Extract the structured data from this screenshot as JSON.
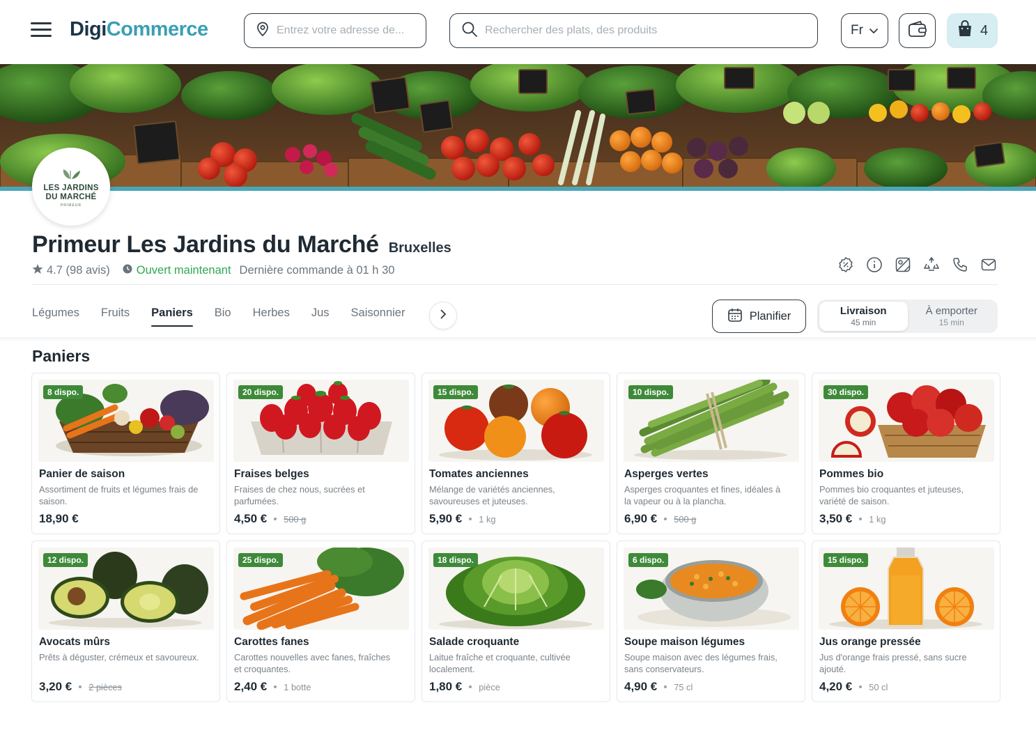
{
  "header": {
    "logo_part1": "Digi",
    "logo_part2": "Commerce",
    "address_placeholder": "Entrez votre adresse de...",
    "search_placeholder": "Rechercher des plats, des produits",
    "language": "Fr",
    "cart_count": "4"
  },
  "store": {
    "logo_line1": "LES JARDINS",
    "logo_line2": "DU MARCHÉ",
    "logo_sub": "PRIMEUR",
    "name": "Primeur Les Jardins du Marché",
    "city": "Bruxelles",
    "rating": "4.7 (98 avis)",
    "status": "Ouvert maintenant",
    "last_order": "Dernière commande à 01 h 30"
  },
  "tabs": [
    {
      "label": "Légumes"
    },
    {
      "label": "Fruits"
    },
    {
      "label": "Paniers"
    },
    {
      "label": "Bio"
    },
    {
      "label": "Herbes"
    },
    {
      "label": "Jus"
    },
    {
      "label": "Saisonnier"
    }
  ],
  "active_tab": "Paniers",
  "plan_label": "Planifier",
  "modes": [
    {
      "label": "Livraison",
      "time": "45 min"
    },
    {
      "label": "À emporter",
      "time": "15 min"
    }
  ],
  "section_title": "Paniers",
  "products": [
    {
      "badge": "8 dispo.",
      "name": "Panier de saison",
      "desc": "Assortiment de fruits et légumes frais de saison.",
      "price": "18,90 €",
      "unit": ""
    },
    {
      "badge": "20 dispo.",
      "name": "Fraises belges",
      "desc": "Fraises de chez nous, sucrées et parfumées.",
      "price": "4,50 €",
      "unit": "500 g"
    },
    {
      "badge": "15 dispo.",
      "name": "Tomates anciennes",
      "desc": "Mélange de variétés anciennes, savoureuses et juteuses.",
      "price": "5,90 €",
      "unit": "1 kg"
    },
    {
      "badge": "10 dispo.",
      "name": "Asperges vertes",
      "desc": "Asperges croquantes et fines, idéales à la vapeur ou à la plancha.",
      "price": "6,90 €",
      "unit": "500 g"
    },
    {
      "badge": "30 dispo.",
      "name": "Pommes bio",
      "desc": "Pommes bio croquantes et juteuses, variété de saison.",
      "price": "3,50 €",
      "unit": "1 kg"
    },
    {
      "badge": "12 dispo.",
      "name": "Avocats mûrs",
      "desc": "Prêts à déguster, crémeux et savoureux.",
      "price": "3,20 €",
      "unit": "2 pièces"
    },
    {
      "badge": "25 dispo.",
      "name": "Carottes fanes",
      "desc": "Carottes nouvelles avec fanes, fraîches et croquantes.",
      "price": "2,40 €",
      "unit": "1 botte"
    },
    {
      "badge": "18 dispo.",
      "name": "Salade croquante",
      "desc": "Laitue fraîche et croquante, cultivée localement.",
      "price": "1,80 €",
      "unit": "pièce"
    },
    {
      "badge": "6 dispo.",
      "name": "Soupe maison légumes",
      "desc": "Soupe maison avec des légumes frais, sans conservateurs.",
      "price": "4,90 €",
      "unit": "75 cl"
    },
    {
      "badge": "15 dispo.",
      "name": "Jus orange pressée",
      "desc": "Jus d'orange frais pressé, sans sucre ajouté.",
      "price": "4,20 €",
      "unit": "50 cl"
    }
  ],
  "colors": {
    "brand_dark": "#1b3548",
    "brand_accent": "#3a9fb3",
    "open_green": "#2fa84f",
    "badge_green": "#3e8a3a"
  }
}
